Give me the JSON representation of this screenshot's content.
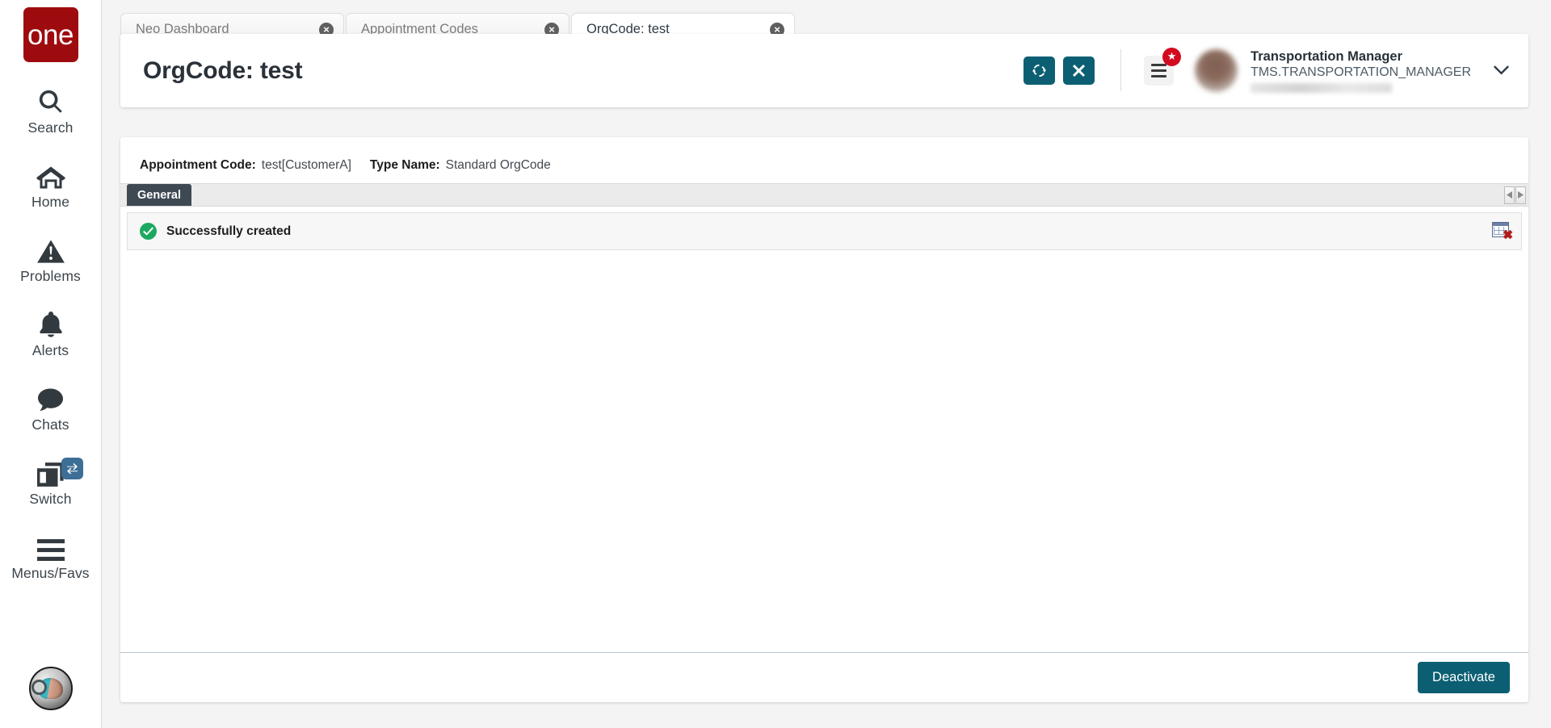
{
  "sidebar": {
    "logo_text": "one",
    "items": [
      {
        "label": "Search",
        "icon": "search-icon"
      },
      {
        "label": "Home",
        "icon": "home-icon"
      },
      {
        "label": "Problems",
        "icon": "warning-triangle-icon"
      },
      {
        "label": "Alerts",
        "icon": "bell-icon"
      },
      {
        "label": "Chats",
        "icon": "chat-bubble-icon"
      },
      {
        "label": "Switch",
        "icon": "windows-stack-icon"
      },
      {
        "label": "Menus/Favs",
        "icon": "hamburger-icon"
      }
    ],
    "switch_badge_icon": "swap-arrows-icon",
    "assistant_icon": "robot-assistant-icon"
  },
  "tabs": [
    {
      "label": "Neo Dashboard",
      "active": false,
      "closable": true
    },
    {
      "label": "Appointment Codes",
      "active": false,
      "closable": true
    },
    {
      "label": "OrgCode: test",
      "active": true,
      "closable": true
    }
  ],
  "header": {
    "title": "OrgCode: test",
    "refresh_button": "refresh-icon",
    "close_button": "close-x-icon",
    "menu_button": "hamburger-menu-icon",
    "badge_icon": "star-icon",
    "user_name": "Transportation Manager",
    "user_role": "TMS.TRANSPORTATION_MANAGER",
    "caret_icon": "chevron-down-icon"
  },
  "summary": {
    "appointment_code_label": "Appointment Code:",
    "appointment_code_value": "test[CustomerA]",
    "type_name_label": "Type Name:",
    "type_name_value": "Standard OrgCode"
  },
  "content_tabs": {
    "general": "General",
    "scroll_left_icon": "arrow-left-icon",
    "scroll_right_icon": "arrow-right-icon"
  },
  "message": {
    "text": "Successfully created",
    "status_icon": "check-circle-icon",
    "action_icon": "grid-remove-icon"
  },
  "footer": {
    "deactivate_label": "Deactivate"
  },
  "colors": {
    "brand_red": "#9e0b0f",
    "accent_teal": "#0c5f72",
    "success_green": "#1da862",
    "tab_dark": "#3e4954",
    "badge_red": "#d30b20",
    "switch_blue": "#3d6e96"
  }
}
